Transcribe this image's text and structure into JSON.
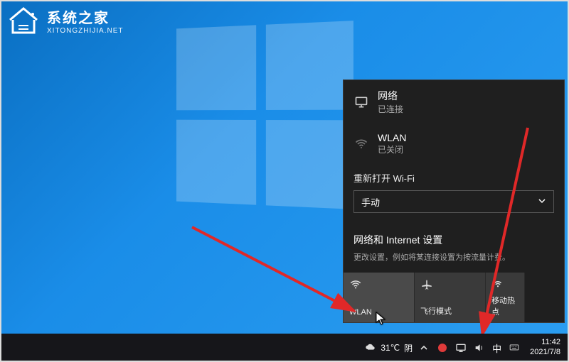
{
  "watermark": {
    "title": "系统之家",
    "subtitle": "XITONGZHIJIA.NET"
  },
  "flyout": {
    "network": {
      "title": "网络",
      "status": "已连接"
    },
    "wlan": {
      "title": "WLAN",
      "status": "已关闭"
    },
    "reopen_label": "重新打开 Wi-Fi",
    "dropdown_value": "手动",
    "settings_link": "网络和 Internet 设置",
    "settings_hint": "更改设置，例如将某连接设置为按流量计费。",
    "tiles": {
      "wlan": "WLAN",
      "airplane": "飞行模式",
      "hotspot": "移动热点"
    }
  },
  "taskbar": {
    "temperature": "31℃",
    "weather_word": "阴",
    "ime": "中",
    "time": "11:42",
    "date": "2021/7/8"
  }
}
